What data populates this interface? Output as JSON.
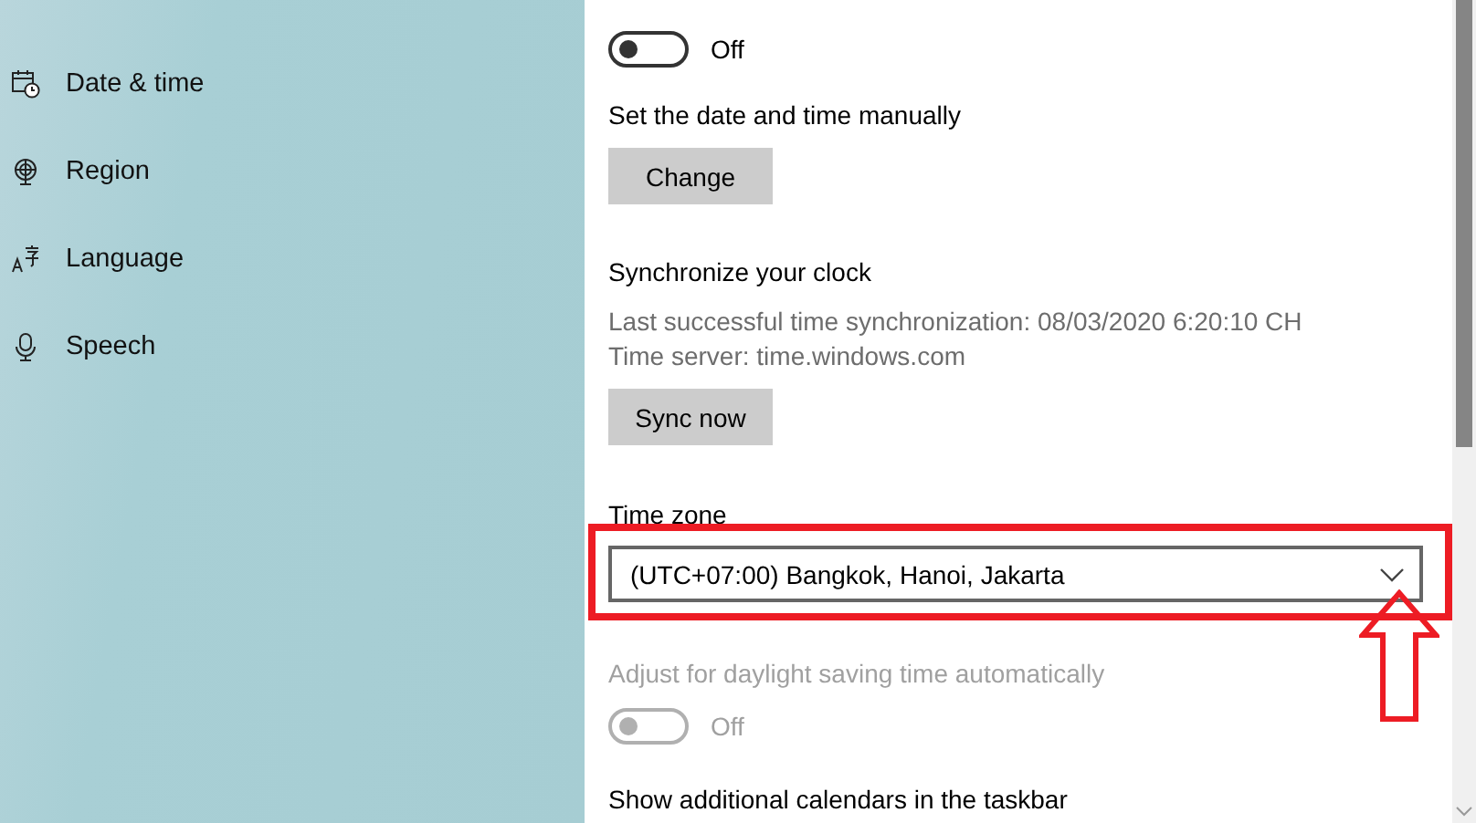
{
  "sidebar": {
    "items": [
      {
        "label": "Date & time"
      },
      {
        "label": "Region"
      },
      {
        "label": "Language"
      },
      {
        "label": "Speech"
      }
    ]
  },
  "settings": [
    {
      "kind": "toggle",
      "on": false,
      "state_text": "Off",
      "disabled": false
    },
    {
      "kind": "button",
      "label": "Set the date and time manually",
      "button": "Change"
    },
    {
      "kind": "sync",
      "label": "Synchronize your clock",
      "lines": [
        "Last successful time synchronization: 08/03/2020 6:20:10 CH",
        "Time server: time.windows.com"
      ],
      "button": "Sync now"
    },
    {
      "kind": "dropdown",
      "label": "Time zone",
      "value": "(UTC+07:00) Bangkok, Hanoi, Jakarta"
    },
    {
      "kind": "toggle",
      "label": "Adjust for daylight saving time automatically",
      "on": false,
      "state_text": "Off",
      "disabled": true
    },
    {
      "kind": "heading",
      "label": "Show additional calendars in the taskbar"
    }
  ]
}
